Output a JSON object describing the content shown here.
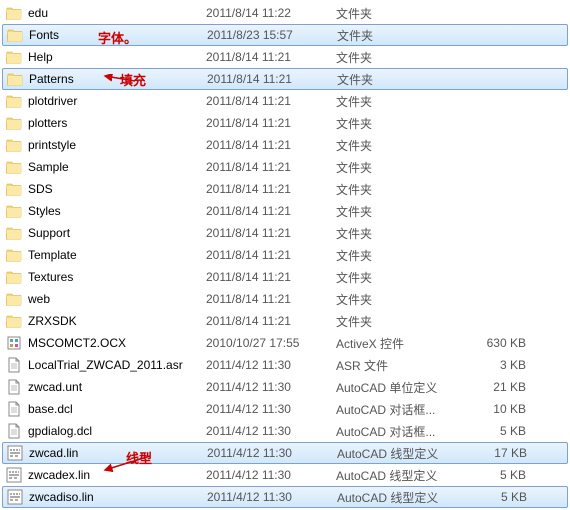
{
  "annotations": {
    "fonts": "字体。",
    "patterns": "填充",
    "lin": "线型"
  },
  "rows": [
    {
      "icon": "folder",
      "name": "edu",
      "date": "2011/8/14 11:22",
      "type": "文件夹",
      "size": "",
      "sel": false
    },
    {
      "icon": "folder",
      "name": "Fonts",
      "date": "2011/8/23 15:57",
      "type": "文件夹",
      "size": "",
      "sel": true
    },
    {
      "icon": "folder",
      "name": "Help",
      "date": "2011/8/14 11:21",
      "type": "文件夹",
      "size": "",
      "sel": false
    },
    {
      "icon": "folder",
      "name": "Patterns",
      "date": "2011/8/14 11:21",
      "type": "文件夹",
      "size": "",
      "sel": true
    },
    {
      "icon": "folder",
      "name": "plotdriver",
      "date": "2011/8/14 11:21",
      "type": "文件夹",
      "size": "",
      "sel": false
    },
    {
      "icon": "folder",
      "name": "plotters",
      "date": "2011/8/14 11:21",
      "type": "文件夹",
      "size": "",
      "sel": false
    },
    {
      "icon": "folder",
      "name": "printstyle",
      "date": "2011/8/14 11:21",
      "type": "文件夹",
      "size": "",
      "sel": false
    },
    {
      "icon": "folder",
      "name": "Sample",
      "date": "2011/8/14 11:21",
      "type": "文件夹",
      "size": "",
      "sel": false
    },
    {
      "icon": "folder",
      "name": "SDS",
      "date": "2011/8/14 11:21",
      "type": "文件夹",
      "size": "",
      "sel": false
    },
    {
      "icon": "folder",
      "name": "Styles",
      "date": "2011/8/14 11:21",
      "type": "文件夹",
      "size": "",
      "sel": false
    },
    {
      "icon": "folder",
      "name": "Support",
      "date": "2011/8/14 11:21",
      "type": "文件夹",
      "size": "",
      "sel": false
    },
    {
      "icon": "folder",
      "name": "Template",
      "date": "2011/8/14 11:21",
      "type": "文件夹",
      "size": "",
      "sel": false
    },
    {
      "icon": "folder",
      "name": "Textures",
      "date": "2011/8/14 11:21",
      "type": "文件夹",
      "size": "",
      "sel": false
    },
    {
      "icon": "folder",
      "name": "web",
      "date": "2011/8/14 11:21",
      "type": "文件夹",
      "size": "",
      "sel": false
    },
    {
      "icon": "folder",
      "name": "ZRXSDK",
      "date": "2011/8/14 11:21",
      "type": "文件夹",
      "size": "",
      "sel": false
    },
    {
      "icon": "ocx",
      "name": "MSCOMCT2.OCX",
      "date": "2010/10/27 17:55",
      "type": "ActiveX 控件",
      "size": "630 KB",
      "sel": false
    },
    {
      "icon": "file",
      "name": "LocalTrial_ZWCAD_2011.asr",
      "date": "2011/4/12 11:30",
      "type": "ASR 文件",
      "size": "3 KB",
      "sel": false
    },
    {
      "icon": "file",
      "name": "zwcad.unt",
      "date": "2011/4/12 11:30",
      "type": "AutoCAD 单位定义",
      "size": "21 KB",
      "sel": false
    },
    {
      "icon": "file",
      "name": "base.dcl",
      "date": "2011/4/12 11:30",
      "type": "AutoCAD 对话框...",
      "size": "10 KB",
      "sel": false
    },
    {
      "icon": "file",
      "name": "gpdialog.dcl",
      "date": "2011/4/12 11:30",
      "type": "AutoCAD 对话框...",
      "size": "5 KB",
      "sel": false
    },
    {
      "icon": "lin",
      "name": "zwcad.lin",
      "date": "2011/4/12 11:30",
      "type": "AutoCAD 线型定义",
      "size": "17 KB",
      "sel": true
    },
    {
      "icon": "lin",
      "name": "zwcadex.lin",
      "date": "2011/4/12 11:30",
      "type": "AutoCAD 线型定义",
      "size": "5 KB",
      "sel": false
    },
    {
      "icon": "lin",
      "name": "zwcadiso.lin",
      "date": "2011/4/12 11:30",
      "type": "AutoCAD 线型定义",
      "size": "5 KB",
      "sel": true
    }
  ]
}
